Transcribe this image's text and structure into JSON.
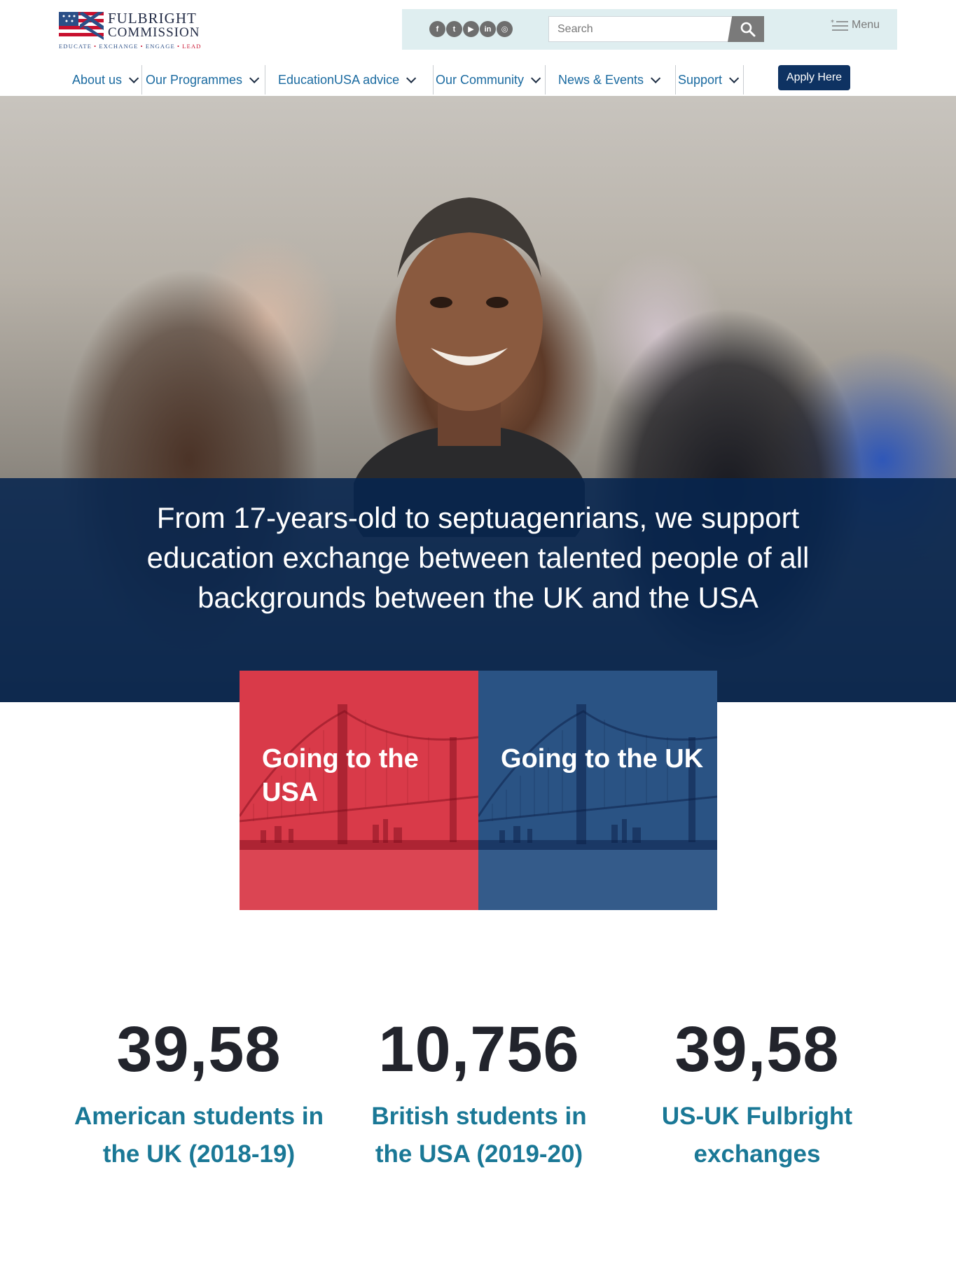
{
  "logo": {
    "title_line1": "FULBRIGHT",
    "title_line2": "COMMISSION",
    "tagline": [
      "EDUCATE",
      "EXCHANGE",
      "ENGAGE",
      "LEAD"
    ]
  },
  "utility": {
    "socials": [
      {
        "icon": "facebook-icon",
        "glyph": "f"
      },
      {
        "icon": "twitter-icon",
        "glyph": "t"
      },
      {
        "icon": "youtube-icon",
        "glyph": "▶"
      },
      {
        "icon": "linkedin-icon",
        "glyph": "in"
      },
      {
        "icon": "instagram-icon",
        "glyph": "◎"
      }
    ],
    "search_placeholder": "Search",
    "menu_label": "Menu"
  },
  "nav": {
    "items": [
      {
        "label": "About us"
      },
      {
        "label": "Our Programmes"
      },
      {
        "label": "EducationUSA advice"
      },
      {
        "label": "Our Community"
      },
      {
        "label": "News & Events"
      },
      {
        "label": "Support"
      }
    ],
    "apply_label": "Apply Here"
  },
  "hero": {
    "text": "From 17-years-old to septuagenrians, we support education exchange between talented people of all backgrounds between the UK and the USA"
  },
  "cards": [
    {
      "title": "Going to the USA",
      "color": "#d93a49"
    },
    {
      "title": "Going to the UK",
      "color": "#2a5384"
    }
  ],
  "stats": [
    {
      "number": "39,58",
      "label": "American students in the UK (2018-19)"
    },
    {
      "number": "10,756",
      "label": "British students in the USA (2019-20)"
    },
    {
      "number": "39,58",
      "label": "US-UK Fulbright exchanges"
    }
  ],
  "colors": {
    "brand_navy": "#0e3262",
    "link_blue": "#1a6aa0",
    "stat_teal": "#1a7896",
    "utility_bg": "#dfeef0"
  }
}
